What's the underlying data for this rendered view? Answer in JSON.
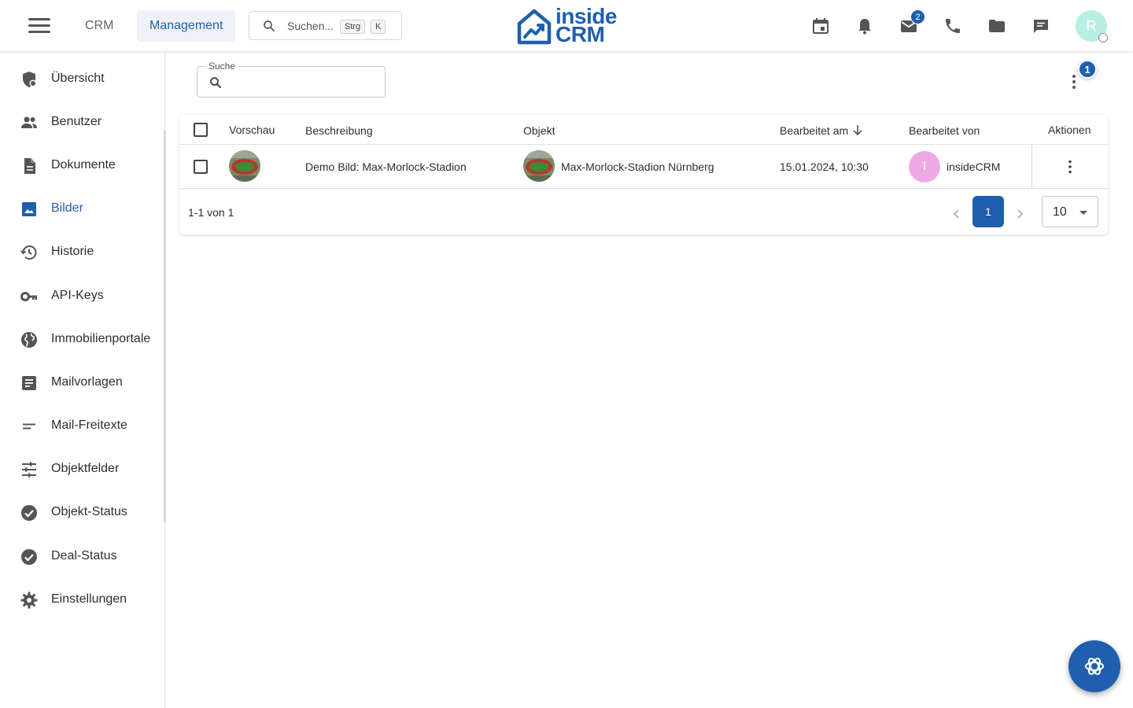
{
  "header": {
    "nav_tabs": [
      {
        "label": "CRM",
        "active": false
      },
      {
        "label": "Management",
        "active": true
      }
    ],
    "search": {
      "placeholder": "Suchen...",
      "shortcut_keys": [
        "Strg",
        "K"
      ]
    },
    "logo": {
      "line1": "inside",
      "line2": "CRM"
    },
    "icons": [
      "calendar-icon",
      "bell-icon",
      "mail-icon",
      "phone-icon",
      "folder-icon",
      "chat-icon"
    ],
    "mail_badge": "2",
    "user_initial": "R"
  },
  "sidebar": {
    "items": [
      {
        "label": "Übersicht",
        "icon": "shield-dashboard-icon",
        "active": false
      },
      {
        "label": "Benutzer",
        "icon": "users-icon",
        "active": false
      },
      {
        "label": "Dokumente",
        "icon": "document-icon",
        "active": false
      },
      {
        "label": "Bilder",
        "icon": "image-icon",
        "active": true
      },
      {
        "label": "Historie",
        "icon": "history-icon",
        "active": false
      },
      {
        "label": "API-Keys",
        "icon": "key-icon",
        "active": false
      },
      {
        "label": "Immobilienportale",
        "icon": "globe-icon",
        "active": false
      },
      {
        "label": "Mailvorlagen",
        "icon": "template-icon",
        "active": false
      },
      {
        "label": "Mail-Freitexte",
        "icon": "short-text-icon",
        "active": false
      },
      {
        "label": "Objektfelder",
        "icon": "sliders-icon",
        "active": false
      },
      {
        "label": "Objekt-Status",
        "icon": "check-circle-icon",
        "active": false
      },
      {
        "label": "Deal-Status",
        "icon": "check-circle-icon",
        "active": false
      },
      {
        "label": "Einstellungen",
        "icon": "gear-icon",
        "active": false
      }
    ]
  },
  "main": {
    "search_label": "Suche",
    "filter_badge": "1",
    "table": {
      "columns": [
        "Vorschau",
        "Beschreibung",
        "Objekt",
        "Bearbeitet am",
        "Bearbeitet von",
        "Aktionen"
      ],
      "sort_column": "Bearbeitet am",
      "sort_direction": "desc",
      "rows": [
        {
          "beschreibung": "Demo Bild: Max-Morlock-Stadion",
          "objekt": "Max-Morlock-Stadion Nürnberg",
          "bearbeitet_am": "15.01.2024, 10:30",
          "bearbeitet_von": "insideCRM",
          "user_initial": "I"
        }
      ]
    },
    "pagination": {
      "range_text": "1-1 von 1",
      "current_page": "1",
      "page_size": "10"
    }
  },
  "colors": {
    "accent": "#1f5fae",
    "avatar_top": "#b9efe3",
    "avatar_user": "#efa8e6"
  }
}
